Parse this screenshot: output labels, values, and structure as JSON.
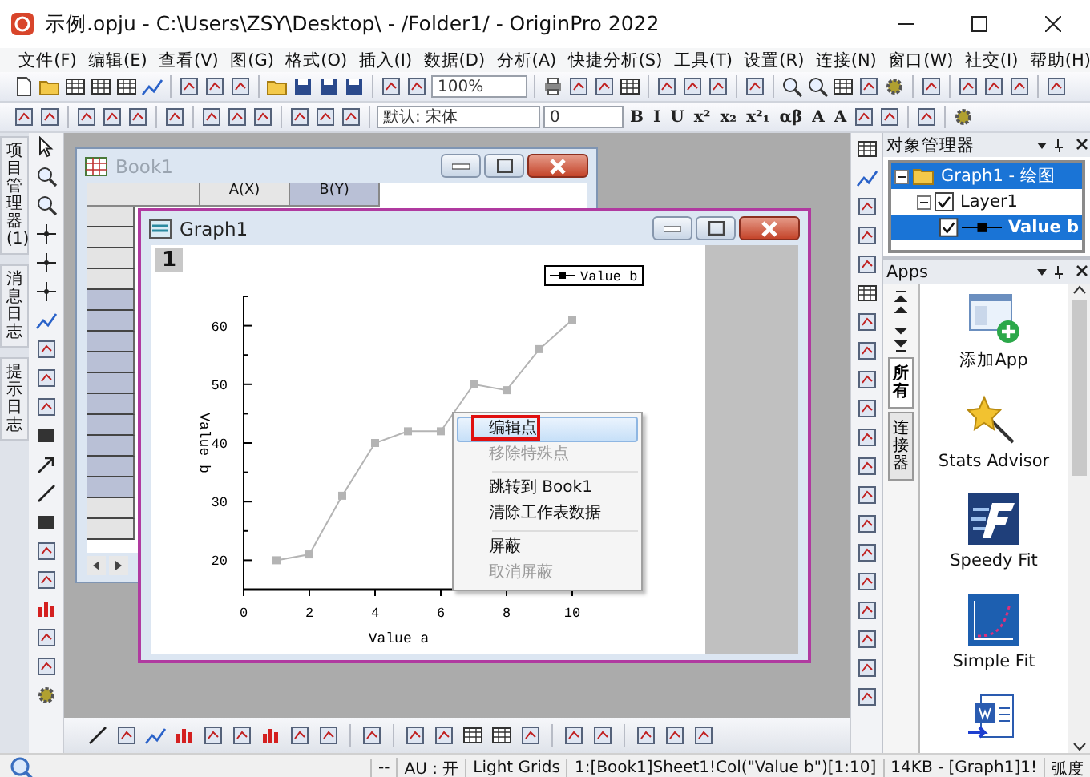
{
  "window": {
    "title": "示例.opju - C:\\Users\\ZSY\\Desktop\\ - /Folder1/ - OriginPro 2022"
  },
  "menu": [
    "文件(F)",
    "编辑(E)",
    "查看(V)",
    "图(G)",
    "格式(O)",
    "插入(I)",
    "数据(D)",
    "分析(A)",
    "快捷分析(S)",
    "工具(T)",
    "设置(R)",
    "连接(N)",
    "窗口(W)",
    "社交(I)",
    "帮助(H)"
  ],
  "toolbar": {
    "zoom": "100%",
    "font": "默认: 宋体",
    "font_size": "0",
    "format_buttons": [
      "B",
      "I",
      "U",
      "x²",
      "x₂",
      "x²₁",
      "αβ",
      "A",
      "A"
    ]
  },
  "side_tabs": [
    {
      "label": "项目管理器 (1)"
    },
    {
      "label": "消息日志"
    },
    {
      "label": "提示日志"
    }
  ],
  "book": {
    "title": "Book1",
    "columns": [
      {
        "label": "A(X)",
        "selected": false
      },
      {
        "label": "B(Y)",
        "selected": true
      }
    ],
    "rows": [
      {
        "selected": false
      },
      {
        "selected": false
      },
      {
        "selected": false
      },
      {
        "selected": false
      },
      {
        "selected": true
      },
      {
        "selected": true
      },
      {
        "selected": true
      },
      {
        "selected": true
      },
      {
        "selected": true
      },
      {
        "selected": true
      },
      {
        "selected": true
      },
      {
        "selected": true
      },
      {
        "selected": true
      },
      {
        "selected": true
      },
      {
        "selected": false
      },
      {
        "selected": false
      }
    ]
  },
  "graph": {
    "title": "Graph1",
    "layer": "1",
    "chart_data": {
      "type": "line",
      "xlabel": "Value a",
      "ylabel": "Value b",
      "x": [
        1,
        2,
        3,
        4,
        5,
        6,
        7,
        8,
        9,
        10
      ],
      "series": [
        {
          "name": "Value b",
          "color": "#b4b4b4",
          "marker": "square",
          "values": [
            20,
            21,
            31,
            40,
            42,
            42,
            50,
            49,
            56,
            61
          ]
        }
      ],
      "xlim": [
        0,
        11
      ],
      "ylim": [
        15,
        65
      ],
      "xticks": [
        0,
        2,
        4,
        6,
        8,
        10
      ],
      "yticks": [
        20,
        30,
        40,
        50,
        60
      ]
    },
    "context_menu": [
      {
        "kind": "item",
        "label": "编辑点",
        "selected": true,
        "disabled": false,
        "marked": true
      },
      {
        "kind": "item",
        "label": "移除特殊点",
        "selected": false,
        "disabled": true,
        "marked": false
      },
      {
        "kind": "separator"
      },
      {
        "kind": "item",
        "label": "跳转到 Book1",
        "selected": false,
        "disabled": false,
        "marked": false
      },
      {
        "kind": "item",
        "label": "清除工作表数据",
        "selected": false,
        "disabled": false,
        "marked": false
      },
      {
        "kind": "separator"
      },
      {
        "kind": "item",
        "label": "屏蔽",
        "selected": false,
        "disabled": false,
        "marked": false
      },
      {
        "kind": "item",
        "label": "取消屏蔽",
        "selected": false,
        "disabled": true,
        "marked": false
      }
    ]
  },
  "object_manager": {
    "title": "对象管理器",
    "tree": [
      {
        "label": "Graph1 - 绘图",
        "expanded": true,
        "selected": true,
        "children": [
          {
            "label": "Layer1",
            "expanded": true,
            "checked": true,
            "selected": false,
            "children": [
              {
                "label": "Value b",
                "checked": true,
                "selected": true
              }
            ]
          }
        ]
      }
    ]
  },
  "apps": {
    "title": "Apps",
    "tabs": [
      {
        "label": "所有",
        "selected": true
      },
      {
        "label": "连接器",
        "selected": false
      }
    ],
    "items": [
      {
        "kind": "add",
        "label": "添加App"
      },
      {
        "kind": "wand",
        "label": "Stats Advisor"
      },
      {
        "kind": "speedy",
        "label": "Speedy Fit"
      },
      {
        "kind": "curve",
        "label": "Simple Fit"
      },
      {
        "kind": "word"
      }
    ]
  },
  "status_bar": [
    "--",
    "AU : 开",
    "Light Grids",
    "1:[Book1]Sheet1!Col(\"Value b\")[1:10]",
    "14KB - [Graph1]1!",
    "弧度"
  ]
}
